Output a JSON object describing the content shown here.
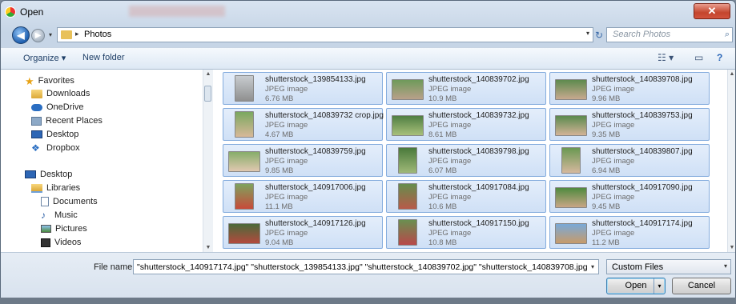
{
  "window": {
    "title": "Open",
    "close_glyph": "✕"
  },
  "nav": {
    "back_glyph": "◀",
    "forward_glyph": "▶",
    "breadcrumb_sep": "▸",
    "breadcrumb": "Photos",
    "refresh_glyph": "↻",
    "search_placeholder": "Search Photos",
    "search_glyph": "⌕"
  },
  "toolbar": {
    "organize": "Organize ▾",
    "new_folder": "New folder",
    "views_glyph": "☷ ▾",
    "pane_glyph": "▭",
    "help_glyph": "?"
  },
  "sidebar": {
    "items": [
      {
        "label": "Favorites",
        "icon": "star-icon"
      },
      {
        "label": "Downloads",
        "icon": "downloads-folder-icon"
      },
      {
        "label": "OneDrive",
        "icon": "cloud-icon"
      },
      {
        "label": "Recent Places",
        "icon": "recent-places-icon"
      },
      {
        "label": "Desktop",
        "icon": "desktop-icon"
      },
      {
        "label": "Dropbox",
        "icon": "dropbox-icon"
      },
      {
        "label": "Desktop",
        "icon": "desktop-icon"
      },
      {
        "label": "Libraries",
        "icon": "libraries-icon"
      },
      {
        "label": "Documents",
        "icon": "documents-icon"
      },
      {
        "label": "Music",
        "icon": "music-icon"
      },
      {
        "label": "Pictures",
        "icon": "pictures-icon"
      },
      {
        "label": "Videos",
        "icon": "videos-icon"
      }
    ]
  },
  "files": [
    {
      "name": "shutterstock_139854133.jpg",
      "type": "JPEG image",
      "size": "6.76 MB"
    },
    {
      "name": "shutterstock_140839702.jpg",
      "type": "JPEG image",
      "size": "10.9 MB"
    },
    {
      "name": "shutterstock_140839708.jpg",
      "type": "JPEG image",
      "size": "9.96 MB"
    },
    {
      "name": "shutterstock_140839732 crop.jpg",
      "type": "JPEG image",
      "size": "4.67 MB"
    },
    {
      "name": "shutterstock_140839732.jpg",
      "type": "JPEG image",
      "size": "8.61 MB"
    },
    {
      "name": "shutterstock_140839753.jpg",
      "type": "JPEG image",
      "size": "9.35 MB"
    },
    {
      "name": "shutterstock_140839759.jpg",
      "type": "JPEG image",
      "size": "9.85 MB"
    },
    {
      "name": "shutterstock_140839798.jpg",
      "type": "JPEG image",
      "size": "6.07 MB"
    },
    {
      "name": "shutterstock_140839807.jpg",
      "type": "JPEG image",
      "size": "6.94 MB"
    },
    {
      "name": "shutterstock_140917006.jpg",
      "type": "JPEG image",
      "size": "11.1 MB"
    },
    {
      "name": "shutterstock_140917084.jpg",
      "type": "JPEG image",
      "size": "10.6 MB"
    },
    {
      "name": "shutterstock_140917090.jpg",
      "type": "JPEG image",
      "size": "9.45 MB"
    },
    {
      "name": "shutterstock_140917126.jpg",
      "type": "JPEG image",
      "size": "9.04 MB"
    },
    {
      "name": "shutterstock_140917150.jpg",
      "type": "JPEG image",
      "size": "10.8 MB"
    },
    {
      "name": "shutterstock_140917174.jpg",
      "type": "JPEG image",
      "size": "11.2 MB"
    }
  ],
  "bottom": {
    "file_name_label": "File name:",
    "file_name_value": "\"shutterstock_140917174.jpg\" \"shutterstock_139854133.jpg\" \"shutterstock_140839702.jpg\" \"shutterstock_140839708.jpg\" \"shutterstock",
    "file_type": "Custom Files",
    "open_label": "Open",
    "cancel_label": "Cancel",
    "drop_glyph": "▾"
  }
}
